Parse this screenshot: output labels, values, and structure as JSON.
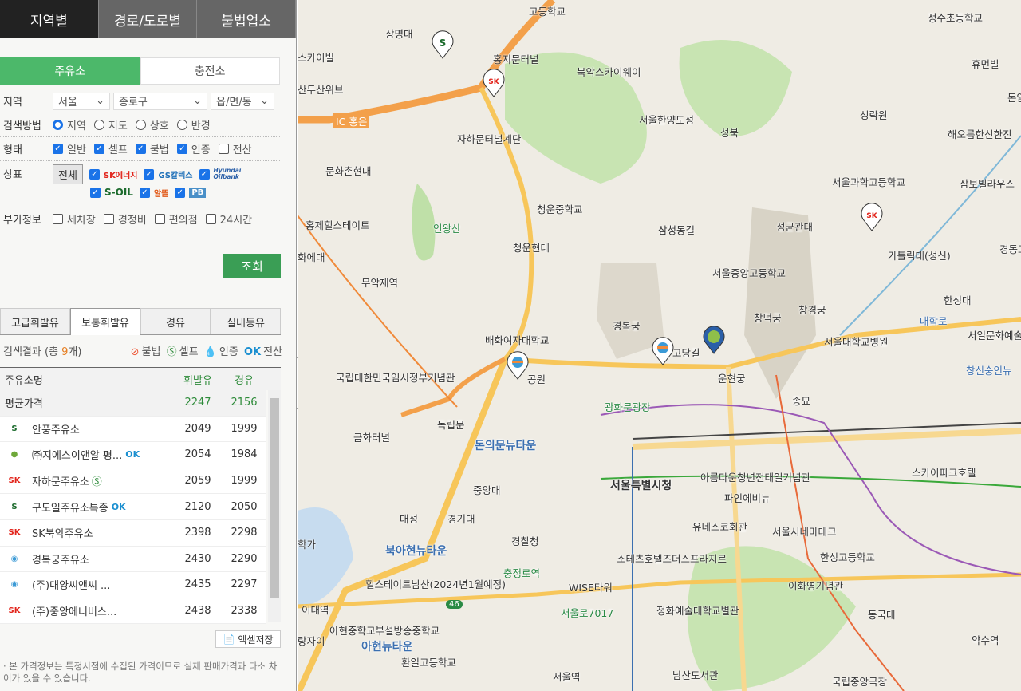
{
  "top_tabs": [
    {
      "label": "지역별",
      "active": true
    },
    {
      "label": "경로/도로별"
    },
    {
      "label": "불법업소"
    }
  ],
  "sub_tabs": [
    {
      "label": "주유소",
      "active": true
    },
    {
      "label": "충전소"
    }
  ],
  "filters": {
    "region_label": "지역",
    "sido": "서울",
    "sigungu": "종로구",
    "dong": "읍/면/동",
    "method_label": "검색방법",
    "methods": [
      {
        "label": "지역",
        "checked": true
      },
      {
        "label": "지도"
      },
      {
        "label": "상호"
      },
      {
        "label": "반경"
      }
    ],
    "type_label": "형태",
    "types": [
      {
        "label": "일반",
        "checked": true
      },
      {
        "label": "셀프",
        "checked": true
      },
      {
        "label": "불법",
        "checked": true
      },
      {
        "label": "인증",
        "checked": true
      },
      {
        "label": "전산",
        "checked": false
      }
    ],
    "brand_label": "상표",
    "all_button": "전체",
    "brands": [
      {
        "name": "SK에너지",
        "checked": true
      },
      {
        "name": "GS칼텍스",
        "checked": true
      },
      {
        "name": "Hyundai Oilbank",
        "checked": true
      },
      {
        "name": "S-OIL",
        "checked": true
      },
      {
        "name": "알뜰",
        "checked": true
      },
      {
        "name": "PB",
        "checked": true
      }
    ],
    "extra_label": "부가정보",
    "extras": [
      {
        "label": "세차장"
      },
      {
        "label": "경정비"
      },
      {
        "label": "편의점"
      },
      {
        "label": "24시간"
      }
    ],
    "search_button": "조회"
  },
  "fuel_tabs": [
    {
      "label": "고급휘발유"
    },
    {
      "label": "보통휘발유",
      "active": true
    },
    {
      "label": "경유"
    },
    {
      "label": "실내등유"
    }
  ],
  "results": {
    "prefix": "검색결과 (총 ",
    "count": "9",
    "suffix": "개)",
    "legend": [
      "불법",
      "셀프",
      "인증",
      "전산"
    ],
    "headers": {
      "name": "주유소명",
      "gasoline": "휘발유",
      "diesel": "경유"
    },
    "average": {
      "label": "평균가격",
      "gasoline": "2247",
      "diesel": "2156"
    },
    "rows": [
      {
        "brand": "s-oil",
        "name": "안풍주유소",
        "badge": "",
        "gasoline": "2049",
        "diesel": "1999"
      },
      {
        "brand": "hyundai",
        "name": "㈜지에스이앤알 평...",
        "badge": "전산",
        "gasoline": "2054",
        "diesel": "1984"
      },
      {
        "brand": "sk",
        "name": "자하문주유소",
        "badge": "셀프",
        "gasoline": "2059",
        "diesel": "1999"
      },
      {
        "brand": "s-oil",
        "name": "구도일주유소특종",
        "badge": "전산",
        "gasoline": "2120",
        "diesel": "2050"
      },
      {
        "brand": "sk",
        "name": "SK북악주유소",
        "badge": "",
        "gasoline": "2398",
        "diesel": "2298"
      },
      {
        "brand": "gs",
        "name": "경복궁주유소",
        "badge": "",
        "gasoline": "2430",
        "diesel": "2290"
      },
      {
        "brand": "gs",
        "name": "(주)대양씨앤씨 ...",
        "badge": "",
        "gasoline": "2435",
        "diesel": "2297"
      },
      {
        "brand": "sk",
        "name": "(주)중앙에너비스...",
        "badge": "",
        "gasoline": "2438",
        "diesel": "2338"
      }
    ],
    "excel_button": "엑셀저장",
    "note": "· 본 가격정보는 특정시점에 수집된 가격이므로 실제 판매가격과 다소 차이가 있을 수 있습니다."
  },
  "colors": {
    "accent": "#4cb86a",
    "button": "#3a9e55",
    "price": "#2e8b3a",
    "count": "#e67e22"
  },
  "map": {
    "labels": [
      "고등학교",
      "상명대",
      "스카이빌",
      "산두산위브",
      "홍지문터널",
      "북악스카이웨이",
      "정수초등학교",
      "휴먼빌",
      "돈암",
      "서울한양도성",
      "성북",
      "성락원",
      "해오름한신한진",
      "자하문터널계단",
      "문화촌현대",
      "서울과학고등학교",
      "삼보빌라우스",
      "홍제힐스테이트",
      "인왕산",
      "청운중학교",
      "삼청동길",
      "성균관대",
      "가톨릭대(성신)",
      "경동고",
      "청운현대",
      "화에대",
      "무악재역",
      "서울중앙고등학교",
      "한성대",
      "창경궁",
      "창덕궁",
      "경복궁",
      "대학로",
      "서울대학교병원",
      "서일문화예술고등학교",
      "창신숭인뉴",
      "배화여자대학교",
      "국립대한민국임시정부기념관",
      "운현궁",
      "종묘",
      "광화문광장",
      "독립문",
      "금화터널",
      "돈의문뉴타운",
      "서울특별시청",
      "아름다운청년전태일기념관",
      "스카이파크호텔",
      "중앙대",
      "대성",
      "경기대",
      "파인에비뉴",
      "경찰청",
      "유네스코회관",
      "서울시네마테크",
      "학가",
      "북아현뉴타운",
      "소테츠호텔즈더스프라지르",
      "충정로역",
      "한성고등학교",
      "힐스테이트남산(2024년1월예정)",
      "이화영기념관",
      "WISE타워",
      "이대역",
      "정화예술대학교별관",
      "동국대",
      "서울로7017",
      "약수역",
      "아현중학교부설방송중학교",
      "랑자이",
      "아현뉴타운",
      "서울역",
      "환일고등학교",
      "남산도서관",
      "국립중앙극장",
      "IC 홍은",
      "46",
      "고당길",
      "공원"
    ]
  }
}
